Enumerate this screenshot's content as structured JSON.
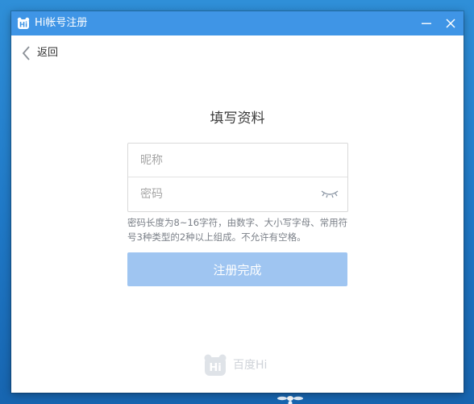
{
  "window": {
    "title": "Hi帐号注册",
    "logo_icon": "baidu-hi-logo-icon",
    "controls": [
      "minimize-icon",
      "close-icon"
    ],
    "titlebar_color": "#3f95e6"
  },
  "nav": {
    "back_label": "返回",
    "back_icon": "chevron-left-icon"
  },
  "form": {
    "title": "填写资料",
    "nickname": {
      "placeholder": "昵称",
      "value": ""
    },
    "password": {
      "placeholder": "密码",
      "value": "",
      "toggle_icon": "eye-closed-icon"
    },
    "hint": "密码长度为8~16字符，由数字、大小写字母、常用符号3种类型的2种以上组成。不允许有空格。",
    "submit_label": "注册完成",
    "submit_color": "#9fc5f1"
  },
  "footer": {
    "brand_text": "百度Hi",
    "logo_icon": "baidu-hi-logo-icon"
  }
}
